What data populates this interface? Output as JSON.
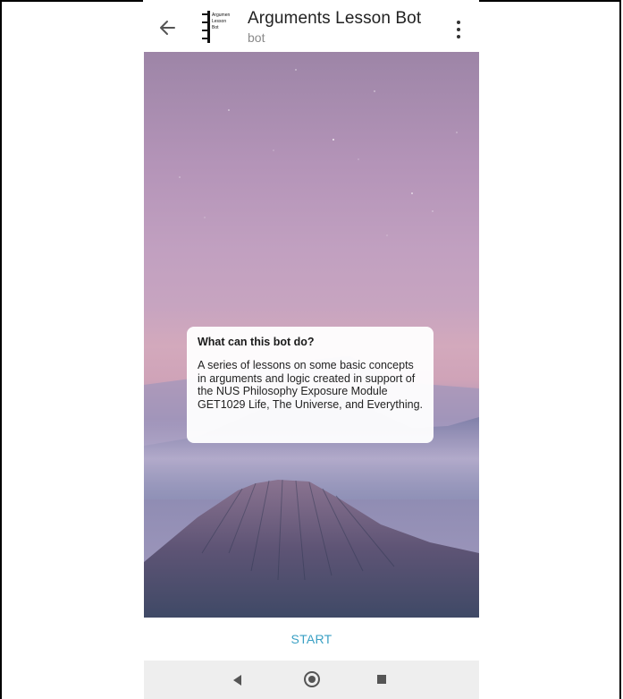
{
  "header": {
    "back_icon": "arrow-left-icon",
    "avatar_text": "Argumen\nLesson\nBot",
    "title": "Arguments Lesson Bot",
    "subtitle": "bot",
    "menu_icon": "more-vertical-icon"
  },
  "info_card": {
    "title": "What can this bot do?",
    "body": "A series of lessons on some basic concepts in arguments and logic created in support of the NUS Philosophy Exposure Module GET1029 Life, The Universe, and Everything."
  },
  "actions": {
    "start_label": "START"
  },
  "navigation_bar": {
    "back_icon": "triangle-back-icon",
    "home_icon": "circle-home-icon",
    "recents_icon": "square-recents-icon"
  },
  "colors": {
    "accent": "#3aa0c4",
    "navbar_bg": "#eeeeee"
  }
}
